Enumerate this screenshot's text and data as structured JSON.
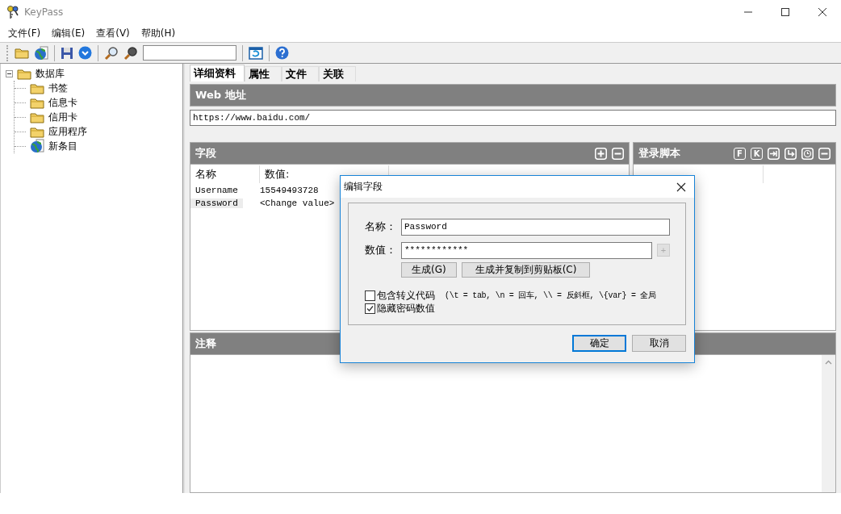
{
  "window": {
    "title": "KeyPass"
  },
  "menu": [
    "文件(F)",
    "编辑(E)",
    "查看(V)",
    "帮助(H)"
  ],
  "tree": {
    "label": "数据库",
    "expanded": true,
    "children": [
      {
        "label": "书签",
        "kind": "folder"
      },
      {
        "label": "信息卡",
        "kind": "folder"
      },
      {
        "label": "信用卡",
        "kind": "folder"
      },
      {
        "label": "应用程序",
        "kind": "folder"
      },
      {
        "label": "新条目",
        "kind": "entry"
      }
    ]
  },
  "tabs": [
    {
      "label": "详细资料",
      "selected": true
    },
    {
      "label": "属性",
      "selected": false
    },
    {
      "label": "文件",
      "selected": false
    },
    {
      "label": "关联",
      "selected": false
    }
  ],
  "web_address": {
    "heading": "Web 地址",
    "value": "https://www.baidu.com/"
  },
  "fields": {
    "heading": "字段",
    "columns": [
      "名称",
      "数值:"
    ],
    "rows": [
      {
        "name": "Username",
        "value": "15549493728",
        "selected": false
      },
      {
        "name": "Password",
        "value": "<Change value>",
        "selected": true
      }
    ]
  },
  "login_script": {
    "heading": "登录脚本",
    "letter_buttons": [
      "F",
      "K"
    ]
  },
  "notes": {
    "heading": "注释"
  },
  "dialog": {
    "title": "编辑字段",
    "name_label": "名称：",
    "name_value": "Password",
    "value_label": "数值：",
    "value_value": "************",
    "add_button": {
      "label": "+",
      "disabled": true
    },
    "buttons": [
      "生成(G)",
      "生成并复制到剪贴板(C)"
    ],
    "options": [
      {
        "label": "包含转义代码",
        "hint": "(\\t = tab, \\n = 回车, \\\\ = 反斜框, \\{var} = 全局",
        "checked": false
      },
      {
        "label": "隐藏密码数值",
        "checked": true
      }
    ],
    "ok": "确定",
    "cancel": "取消"
  }
}
